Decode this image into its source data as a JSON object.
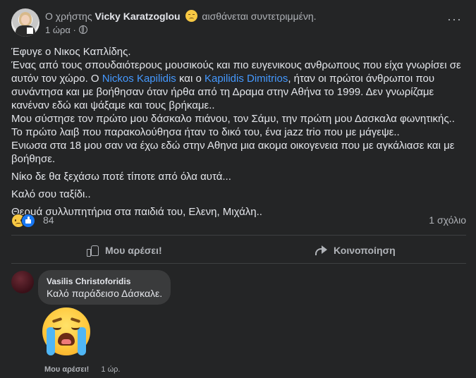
{
  "post": {
    "header": {
      "prefix": "Ο χρήστης",
      "author": "Vicky Karatzoglou",
      "feeling_icon": "sad-face-icon",
      "feeling": "αισθάνεται συντετριμμένη.",
      "time": "1 ώρα ·",
      "audience_icon": "globe-icon",
      "more_label": "···"
    },
    "text": {
      "line1": "Έφυγε ο Νικος Καπλίδης.",
      "p2_a": "Ένας από τους σπουδαιότερους μουσικούς και πιο ευγενικους ανθρωπους που είχα γνωρίσει σε αυτόν τον χώρο. Ο ",
      "link1": "Nickos Kapilidis",
      "p2_b": " και ο ",
      "link2": "Kapilidis Dimitrios",
      "p2_c": ", ήταν οι πρώτοι άνθρωποι που συνάντησα και με βοήθησαν όταν ήρθα από τη Δραμα στην Αθήνα το 1999. Δεν γνωρίζαμε κανέναν εδώ και ψάξαμε και τους βρήκαμε..",
      "p3": "Μου σύστησε τον πρώτο μου δάσκαλο πιάνου, τον Σάμυ, την πρώτη μου Δασκαλα φωνητικής.. Το πρώτο λαιβ που παρακολούθησα ήταν το δικό του, ένα jazz trio που με μάγεψε..",
      "p4": "Ενιωσα στα 18 μου σαν να έχω εδώ στην Αθηνα μια ακομα οικογενεια που με αγκάλιασε και με βοήθησε.",
      "p5": "Νίκο δε θα ξεχάσω ποτέ τίποτε από όλα αυτά...",
      "p6": "Καλό σου ταξίδι..",
      "p7": "Θερμά συλλυπητήρια στα παιδιά του, Ελενη, Μιχάλη.."
    },
    "reactions": {
      "icons": [
        "sad-reaction-icon",
        "like-reaction-icon"
      ],
      "count": "84",
      "comments": "1 σχόλιο"
    },
    "actions": {
      "like_label": "Μου αρέσει!",
      "share_label": "Κοινοποίηση"
    }
  },
  "comment": {
    "author": "Vasilis Christoforidis",
    "text": "Καλό παράδεισο Δάσκαλε.",
    "sticker": "loudly-crying-face-icon",
    "like_label": "Μου αρέσει!",
    "time": "1 ώρ."
  },
  "colors": {
    "background": "#242526",
    "bubble": "#3a3b3c",
    "link": "#4599ff",
    "text": "#e4e6eb",
    "secondary": "#b0b3b8"
  }
}
